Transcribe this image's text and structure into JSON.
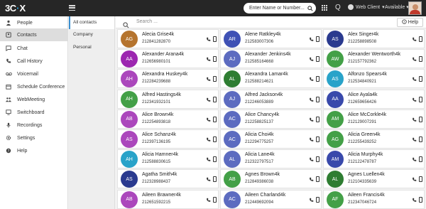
{
  "topbar": {
    "logo": {
      "part1": "3",
      "part2": "C",
      "part3": "X"
    },
    "search_placeholder": "Enter Name or Number...",
    "web_client_label": "Web Client",
    "status_label": "Available"
  },
  "sidebar": {
    "items": [
      {
        "label": "People",
        "icon": "people-icon"
      },
      {
        "label": "Contacts",
        "icon": "contacts-icon"
      },
      {
        "label": "Chat",
        "icon": "chat-icon"
      },
      {
        "label": "Call History",
        "icon": "call-history-icon"
      },
      {
        "label": "Voicemail",
        "icon": "voicemail-icon"
      },
      {
        "label": "Schedule Conference",
        "icon": "schedule-conference-icon"
      },
      {
        "label": "WebMeeting",
        "icon": "webmeeting-icon"
      },
      {
        "label": "Switchboard",
        "icon": "switchboard-icon"
      },
      {
        "label": "Recordings",
        "icon": "recordings-icon"
      },
      {
        "label": "Settings",
        "icon": "settings-icon"
      },
      {
        "label": "Help",
        "icon": "help-icon"
      }
    ]
  },
  "subnav": {
    "items": [
      {
        "label": "All contacts"
      },
      {
        "label": "Company"
      },
      {
        "label": "Personal"
      }
    ]
  },
  "contacts_search": {
    "placeholder": "Search ..."
  },
  "help_button": {
    "label": "Help"
  },
  "contacts": [
    {
      "initials": "AG",
      "name": "Alecia Grise4k",
      "number": "212841282870",
      "color": "#b5742e"
    },
    {
      "initials": "AR",
      "name": "Alene Ratkley4k",
      "number": "212583007306",
      "color": "#3f51b5"
    },
    {
      "initials": "AS",
      "name": "Alex Singer4k",
      "number": "212258898508",
      "color": "#2a3a8f"
    },
    {
      "initials": "AA",
      "name": "Alexander Arana4k",
      "number": "212656980101",
      "color": "#9c27b0"
    },
    {
      "initials": "AJ",
      "name": "Alexander Jenkins4k",
      "number": "212585164668",
      "color": "#5c6bc0"
    },
    {
      "initials": "AW",
      "name": "Alexander Wentworth4k",
      "number": "212157792362",
      "color": "#43a047"
    },
    {
      "initials": "AH",
      "name": "Alexandra Huskey4k",
      "number": "212284239688",
      "color": "#ab47bc"
    },
    {
      "initials": "AL",
      "name": "Alexandra Lamar4k",
      "number": "212588214621",
      "color": "#2e7d32"
    },
    {
      "initials": "AS",
      "name": "Alfonzo Spears4k",
      "number": "212534840921",
      "color": "#29a3c9"
    },
    {
      "initials": "AH",
      "name": "Alfred Hastings4k",
      "number": "212341932101",
      "color": "#43a047"
    },
    {
      "initials": "AJ",
      "name": "Alfred Jackson4k",
      "number": "212246053889",
      "color": "#5c6bc0"
    },
    {
      "initials": "AA",
      "name": "Alice Ayala4k",
      "number": "212659656426",
      "color": "#3949ab"
    },
    {
      "initials": "AB",
      "name": "Alice Brown4k",
      "number": "212254893818",
      "color": "#ab47bc"
    },
    {
      "initials": "AC",
      "name": "Alice Chancy4k",
      "number": "212258825137",
      "color": "#5c6bc0"
    },
    {
      "initials": "AM",
      "name": "Alice McCorkle4k",
      "number": "212129007291",
      "color": "#43a047"
    },
    {
      "initials": "AS",
      "name": "Alice Schanz4k",
      "number": "212397136195",
      "color": "#ab47bc"
    },
    {
      "initials": "AC",
      "name": "Alicia Choi4k",
      "number": "212294775257",
      "color": "#5c6bc0"
    },
    {
      "initials": "AG",
      "name": "Alicia Green4k",
      "number": "212255439252",
      "color": "#43a047"
    },
    {
      "initials": "AH",
      "name": "Alicia Hamner4k",
      "number": "212588830615",
      "color": "#29a3c9"
    },
    {
      "initials": "AL",
      "name": "Alicia Lane4k",
      "number": "212322797517",
      "color": "#5c6bc0"
    },
    {
      "initials": "AM",
      "name": "Alicia Murphy4k",
      "number": "212122478787",
      "color": "#3949ab"
    },
    {
      "initials": "AS",
      "name": "Agatha Smith4k",
      "number": "212328988437",
      "color": "#2a3a8f"
    },
    {
      "initials": "AB",
      "name": "Agnes Brown4k",
      "number": "212849386038",
      "color": "#43a047"
    },
    {
      "initials": "AL",
      "name": "Agnes Luellen4k",
      "number": "212104335639",
      "color": "#2e7d32"
    },
    {
      "initials": "AB",
      "name": "Aileen Brawner4k",
      "number": "212651592215",
      "color": "#ab47bc"
    },
    {
      "initials": "AC",
      "name": "Aileen Charland4k",
      "number": "212449692094",
      "color": "#5c6bc0"
    },
    {
      "initials": "AF",
      "name": "Aileen Francis4k",
      "number": "212347046724",
      "color": "#43a047"
    }
  ]
}
